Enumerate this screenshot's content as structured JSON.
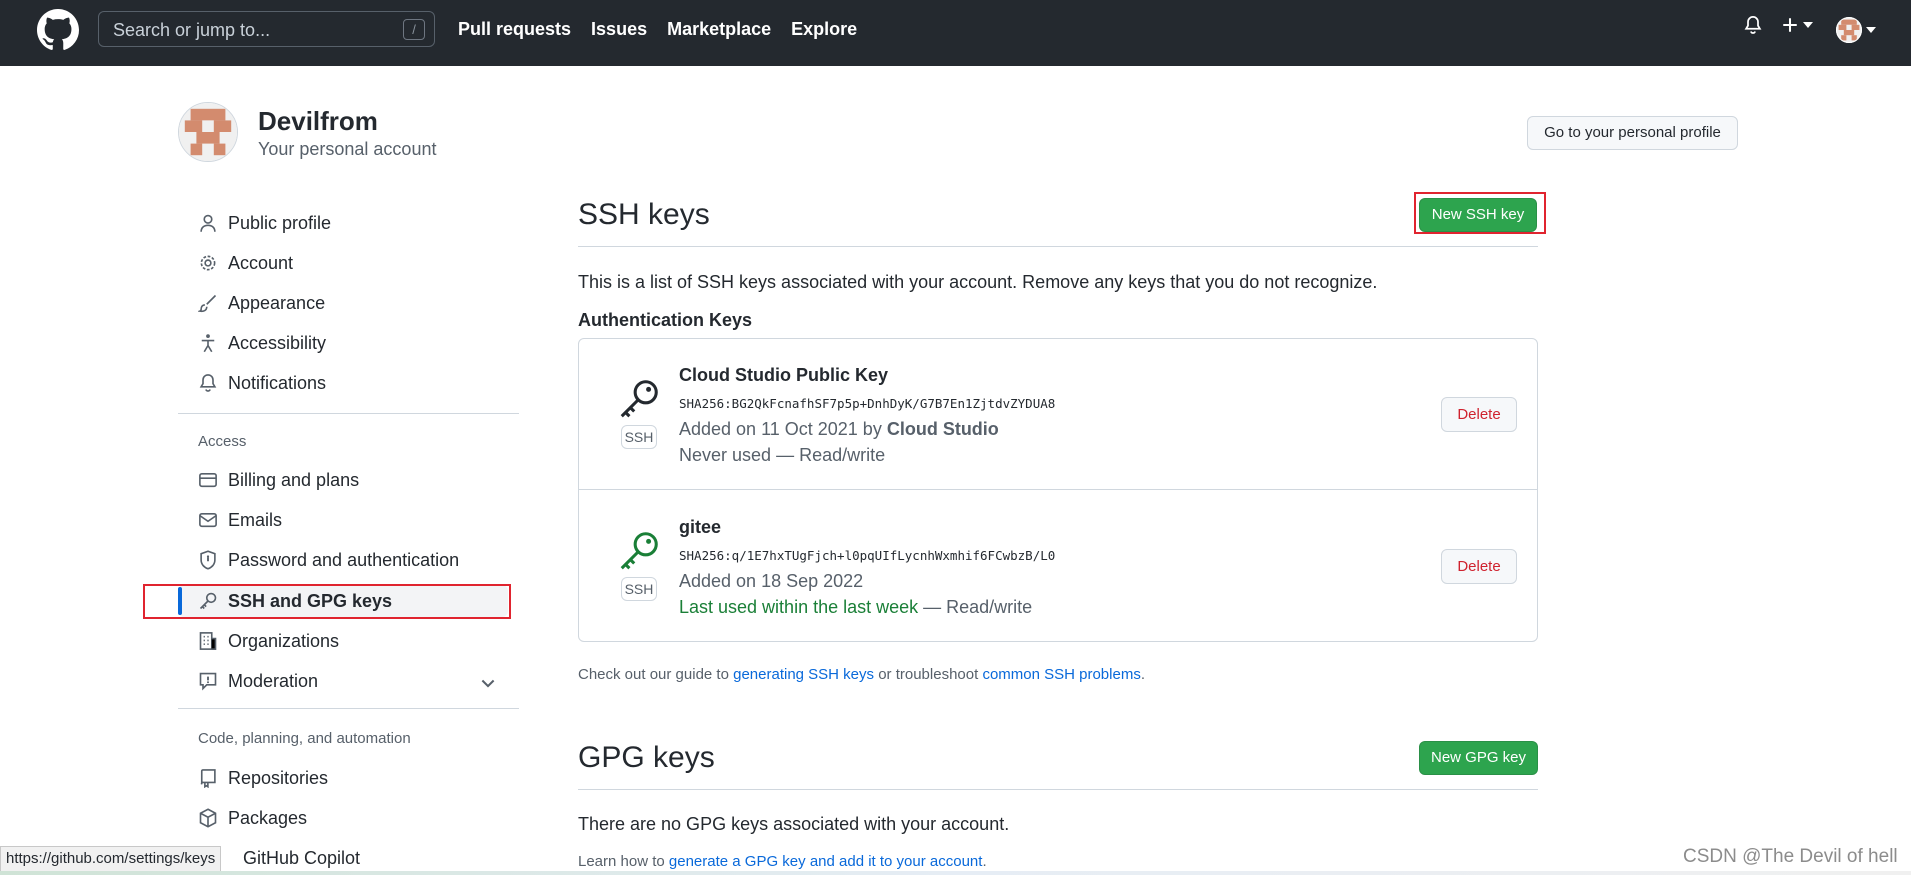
{
  "nav": {
    "search_placeholder": "Search or jump to...",
    "slash_key": "/",
    "links": [
      "Pull requests",
      "Issues",
      "Marketplace",
      "Explore"
    ]
  },
  "account": {
    "name": "Devilfrom",
    "subtitle": "Your personal account",
    "profile_button": "Go to your personal profile"
  },
  "sidebar": {
    "items_top": [
      {
        "label": "Public profile",
        "icon": "person-icon"
      },
      {
        "label": "Account",
        "icon": "gear-icon"
      },
      {
        "label": "Appearance",
        "icon": "paintbrush-icon"
      },
      {
        "label": "Accessibility",
        "icon": "accessibility-icon"
      },
      {
        "label": "Notifications",
        "icon": "bell-icon"
      }
    ],
    "section_access": "Access",
    "items_access": [
      {
        "label": "Billing and plans",
        "icon": "credit-card-icon"
      },
      {
        "label": "Emails",
        "icon": "mail-icon"
      },
      {
        "label": "Password and authentication",
        "icon": "shield-icon"
      },
      {
        "label": "SSH and GPG keys",
        "icon": "key-icon",
        "active": true
      },
      {
        "label": "Organizations",
        "icon": "organization-icon"
      },
      {
        "label": "Moderation",
        "icon": "report-icon"
      }
    ],
    "section_code": "Code, planning, and automation",
    "items_code": [
      {
        "label": "Repositories",
        "icon": "repo-icon"
      },
      {
        "label": "Packages",
        "icon": "package-icon"
      },
      {
        "label": "GitHub Copilot",
        "icon": "copilot-icon"
      }
    ]
  },
  "ssh": {
    "title": "SSH keys",
    "new_button": "New SSH key",
    "intro": "This is a list of SSH keys associated with your account. Remove any keys that you do not recognize.",
    "auth_title": "Authentication Keys",
    "tag": "SSH",
    "keys": [
      {
        "title": "Cloud Studio Public Key",
        "fingerprint": "SHA256:BG2QkFcnafhSF7p5p+DnhDyK/G7B7En1ZjtdvZYDUA8",
        "added_prefix": "Added on 11 Oct 2021 by ",
        "added_by": "Cloud Studio",
        "usage": "Never used",
        "access": " — Read/write",
        "delete": "Delete"
      },
      {
        "title": "gitee",
        "fingerprint": "SHA256:q/1E7hxTUgFjch+l0pqUIfLycnhWxmhif6FCwbzB/L0",
        "added_prefix": "Added on 18 Sep 2022",
        "usage": "Last used within the last week",
        "access": " — Read/write",
        "delete": "Delete"
      }
    ],
    "guide_prefix": "Check out our guide to ",
    "guide_link1": "generating SSH keys",
    "guide_mid": " or troubleshoot ",
    "guide_link2": "common SSH problems",
    "guide_suffix": "."
  },
  "gpg": {
    "title": "GPG keys",
    "new_button": "New GPG key",
    "empty": "There are no GPG keys associated with your account.",
    "learn_prefix": "Learn how to ",
    "learn_link": "generate a GPG key and add it to your account",
    "learn_suffix": "."
  },
  "status_url": "https://github.com/settings/keys",
  "watermark": "CSDN @The Devil of hell",
  "colors": {
    "nav_bg": "#24292f",
    "green_button": "#2da44e",
    "link": "#0969da",
    "danger": "#cf222e",
    "active_indicator": "#0969da",
    "annotation_red": "#e0242f",
    "used_green": "#1a7f37"
  }
}
